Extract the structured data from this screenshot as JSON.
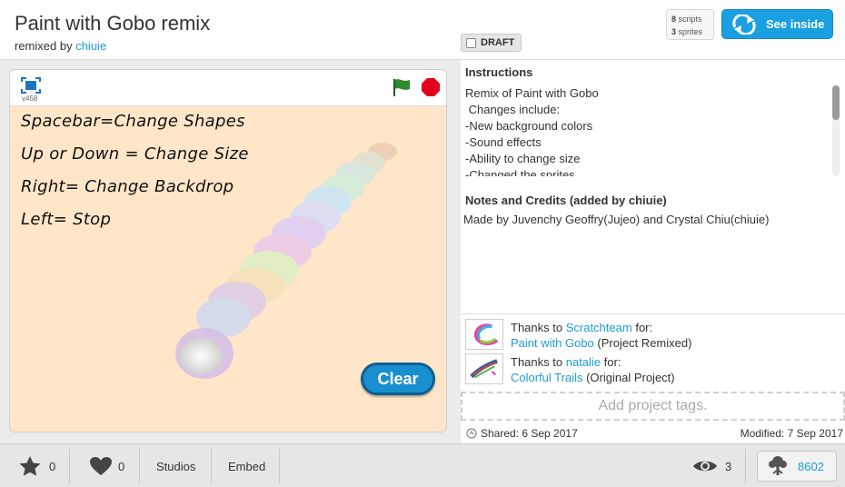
{
  "header": {
    "title": "Paint with Gobo remix",
    "remixed_prefix": "remixed by",
    "remixed_user": "chiuie",
    "draft_label": "DRAFT",
    "scripts_count": "8",
    "scripts_label": "scripts",
    "sprites_count": "3",
    "sprites_label": "sprites",
    "see_inside_label": "See inside"
  },
  "player": {
    "version": "v458",
    "stage_lines": [
      "Spacebar=Change Shapes",
      "Up or Down = Change Size",
      "Right= Change Backdrop",
      "Left= Stop"
    ],
    "clear_label": "Clear",
    "flag_color": "#2e8b2e",
    "stop_color": "#e3001b"
  },
  "instructions": {
    "heading": "Instructions",
    "lines": [
      "Remix of Paint with Gobo",
      " Changes include:",
      "-New background colors",
      "-Sound effects",
      "-Ability to change size",
      "-Changed the sprites"
    ]
  },
  "notes": {
    "heading": "Notes and Credits (added by chiuie)",
    "text": "Made by Juvenchy Geoffry(Jujeo) and Crystal Chiu(chiuie)"
  },
  "credits": [
    {
      "prefix": "Thanks to",
      "user": "Scratchteam",
      "suffix": "for:",
      "project": "Paint with Gobo",
      "type": "(Project Remixed)"
    },
    {
      "prefix": "Thanks to",
      "user": "natalie",
      "suffix": "for:",
      "project": "Colorful Trails",
      "type": "(Original Project)"
    }
  ],
  "tags": {
    "placeholder": "Add project tags."
  },
  "dates": {
    "shared": "Shared: 6 Sep 2017",
    "modified": "Modified: 7 Sep 2017"
  },
  "footer": {
    "favorites": "0",
    "loves": "0",
    "studios_label": "Studios",
    "embed_label": "Embed",
    "views": "3",
    "remix_tree_count": "8602"
  },
  "colors": {
    "accent": "#1aa0e0",
    "link": "#1e9bd7",
    "stage_bg": "#ffe6c8"
  }
}
